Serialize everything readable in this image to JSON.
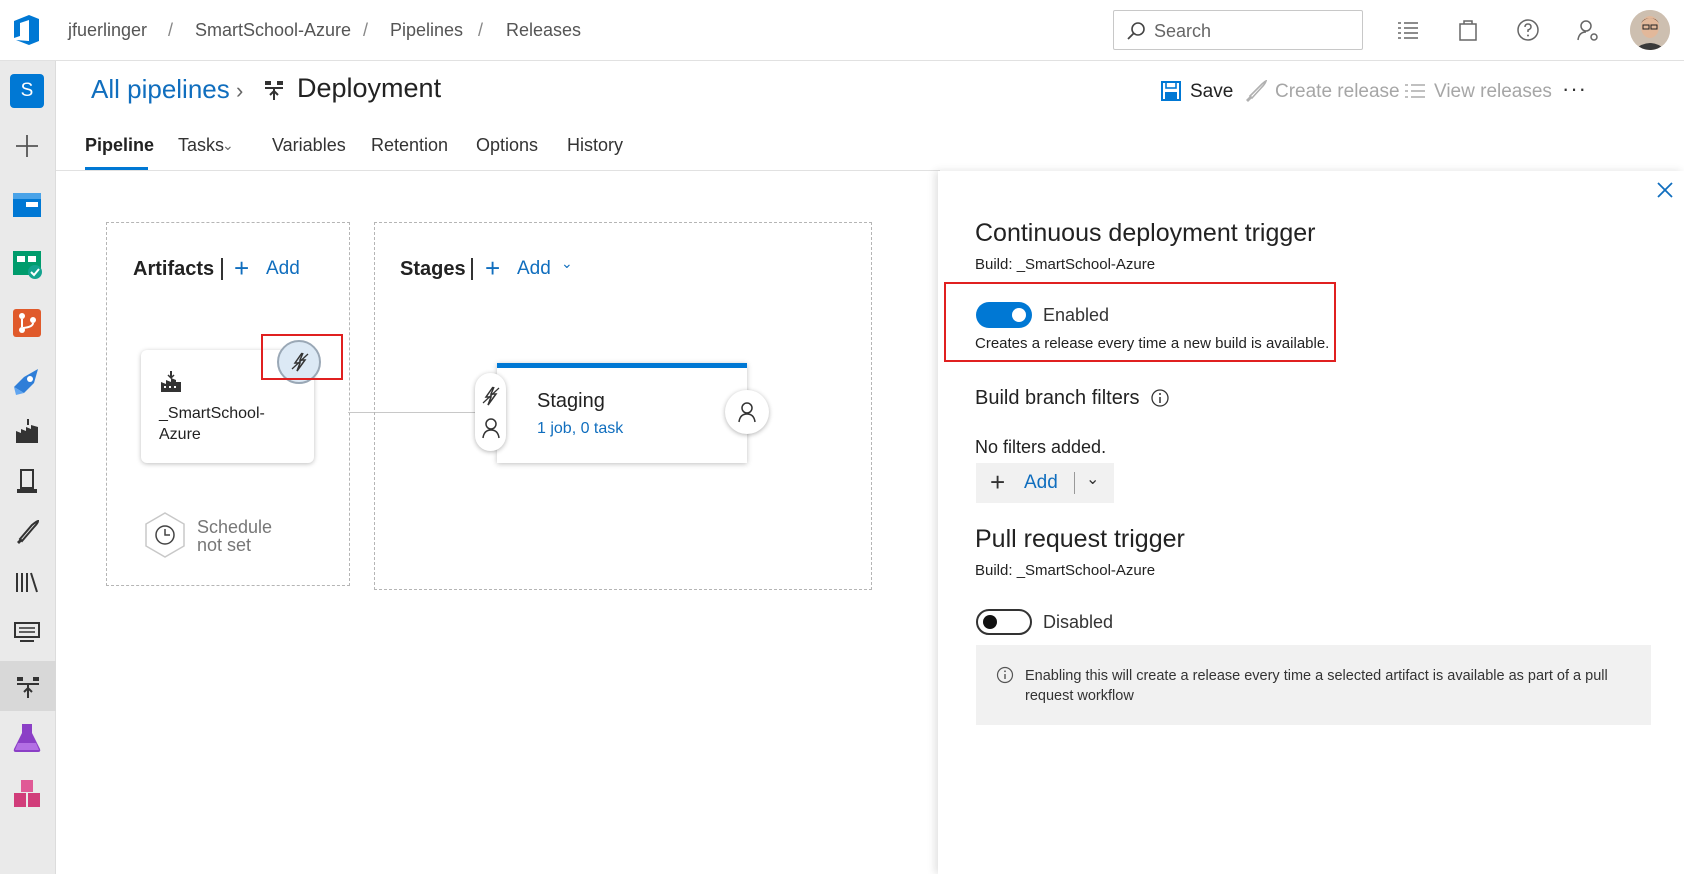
{
  "breadcrumb": {
    "org": "jfuerlinger",
    "project": "SmartSchool-Azure",
    "section": "Pipelines",
    "page": "Releases",
    "separator": "/"
  },
  "search": {
    "placeholder": "Search"
  },
  "project_badge": "S",
  "header": {
    "parent_link": "All pipelines",
    "title": "Deployment",
    "actions": {
      "save": "Save",
      "create_release": "Create release",
      "view_releases": "View releases",
      "more": "···"
    }
  },
  "tabs": [
    {
      "label": "Pipeline",
      "active": true
    },
    {
      "label": "Tasks",
      "active": false
    },
    {
      "label": "Variables",
      "active": false
    },
    {
      "label": "Retention",
      "active": false
    },
    {
      "label": "Options",
      "active": false
    },
    {
      "label": "History",
      "active": false
    }
  ],
  "artifacts": {
    "title": "Artifacts",
    "add_label": "Add",
    "artifact_name": "_SmartSchool-Azure",
    "schedule_line1": "Schedule",
    "schedule_line2": "not set"
  },
  "stages": {
    "title": "Stages",
    "add_label": "Add",
    "stage_name": "Staging",
    "stage_jobs": "1 job, 0 task"
  },
  "panel": {
    "cd_trigger_title": "Continuous deployment trigger",
    "cd_build": "Build: _SmartSchool-Azure",
    "cd_enabled_label": "Enabled",
    "cd_enabled": true,
    "cd_description": "Creates a release every time a new build is available.",
    "branch_filters_title": "Build branch filters",
    "no_filters": "No filters added.",
    "add_label": "Add",
    "pr_trigger_title": "Pull request trigger",
    "pr_build": "Build: _SmartSchool-Azure",
    "pr_disabled_label": "Disabled",
    "pr_enabled": false,
    "pr_info_line1": "Enabling this will create a release every time a selected artifact is available as part of a pull",
    "pr_info_line2": "request workflow"
  },
  "colors": {
    "accent": "#0078d4",
    "link": "#106ebe",
    "highlight_box": "#e02020"
  }
}
